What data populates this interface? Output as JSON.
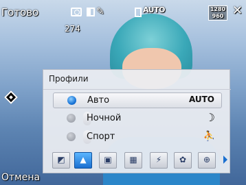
{
  "status": {
    "ready_label": "Готово",
    "shots_remaining": "274",
    "white_balance_label": "AUTO",
    "resolution_top": "1280",
    "resolution_bottom": "960",
    "close_glyph": "✕"
  },
  "panel": {
    "title": "Профили",
    "options": [
      {
        "label": "Авто",
        "icon_glyph": "AUTO",
        "icon_name": "auto-icon",
        "selected": true
      },
      {
        "label": "Ночной",
        "icon_glyph": "☽",
        "icon_name": "night-icon",
        "selected": false
      },
      {
        "label": "Спорт",
        "icon_glyph": "⛹",
        "icon_name": "sport-icon",
        "selected": false
      }
    ],
    "toolbar": [
      {
        "glyph": "◩",
        "icon_name": "profile-icon"
      },
      {
        "glyph": "▲",
        "icon_name": "scene-icon"
      },
      {
        "glyph": "▣",
        "icon_name": "frame-icon"
      },
      {
        "glyph": "▦",
        "icon_name": "quality-icon"
      },
      {
        "glyph": "⚡",
        "icon_name": "flash-icon"
      },
      {
        "glyph": "✿",
        "icon_name": "macro-icon"
      },
      {
        "glyph": "⊕",
        "icon_name": "zoom-icon"
      }
    ],
    "active_tool_index": 1
  },
  "footer": {
    "cancel_label": "Отмена"
  }
}
